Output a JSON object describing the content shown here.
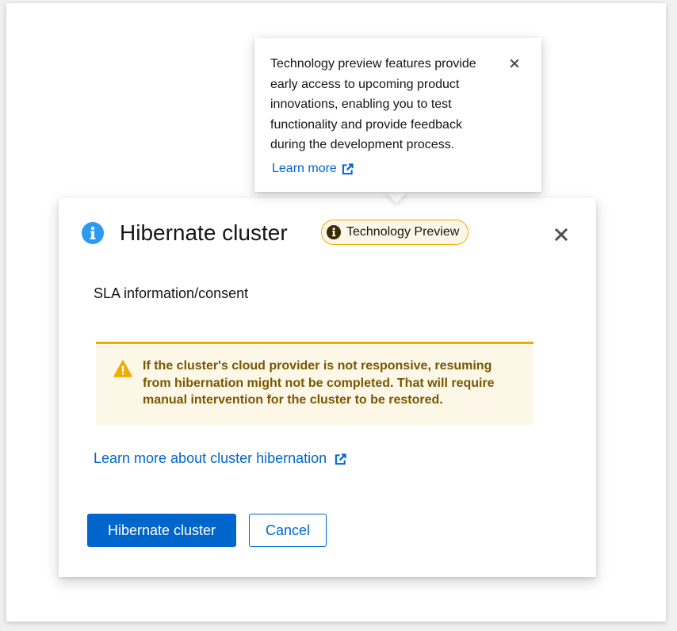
{
  "popover": {
    "body": "Technology preview features provide early access to upcoming product innovations, enabling you to test functionality and provide feedback during the development process.",
    "close_icon": "close-icon",
    "link_label": "Learn more",
    "link_icon": "external-link-icon"
  },
  "modal": {
    "title_icon": "info-circle-icon",
    "title": "Hibernate cluster",
    "badge": {
      "icon": "info-circle-icon",
      "label": "Technology Preview"
    },
    "close_icon": "close-icon",
    "description": "SLA information/consent",
    "alert": {
      "icon": "warning-triangle-icon",
      "text": "If the cluster's cloud provider is not responsive, resuming from hibernation might not be completed. That will require manual intervention for the cluster to be restored."
    },
    "learn_more_label": "Learn more about cluster hibernation",
    "learn_more_icon": "external-link-icon",
    "primary_button": "Hibernate cluster",
    "secondary_button": "Cancel"
  },
  "colors": {
    "primary": "#0066cc",
    "info": "#2b9af3",
    "warning": "#f0ab00",
    "warning_text": "#795600",
    "warning_bg": "#fdf7e7"
  }
}
